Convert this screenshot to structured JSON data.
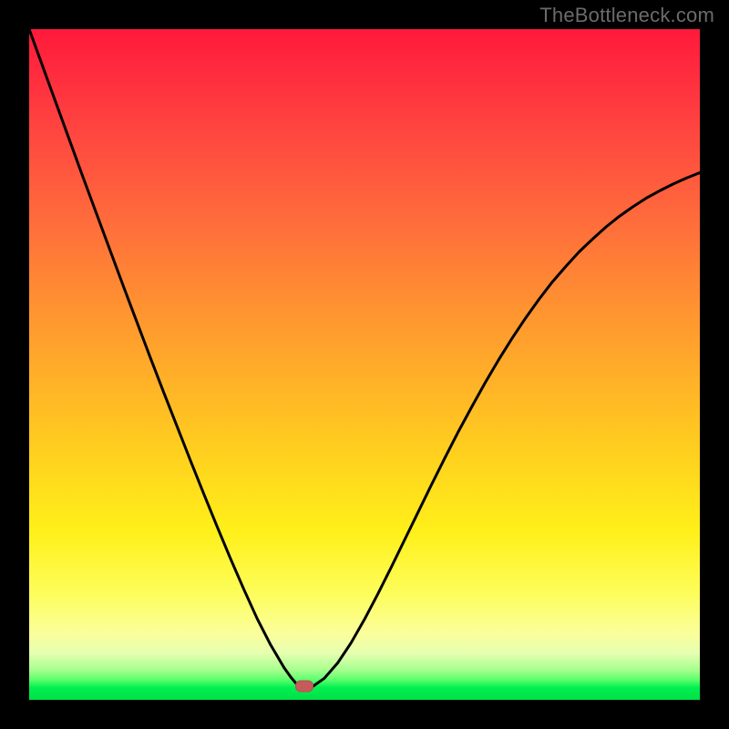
{
  "watermark": "TheBottleneck.com",
  "colors": {
    "frame": "#000000",
    "curve_stroke": "#000000",
    "marker_fill": "#c75a5a"
  },
  "chart_data": {
    "type": "line",
    "title": "",
    "xlabel": "",
    "ylabel": "",
    "xlim": [
      0,
      1
    ],
    "ylim": [
      0,
      1
    ],
    "x": [
      0.0,
      0.02,
      0.04,
      0.06,
      0.08,
      0.1,
      0.12,
      0.14,
      0.16,
      0.18,
      0.2,
      0.22,
      0.24,
      0.26,
      0.28,
      0.3,
      0.32,
      0.34,
      0.36,
      0.38,
      0.39,
      0.4,
      0.405,
      0.41,
      0.42,
      0.44,
      0.46,
      0.48,
      0.5,
      0.52,
      0.54,
      0.56,
      0.58,
      0.6,
      0.62,
      0.64,
      0.66,
      0.68,
      0.7,
      0.72,
      0.74,
      0.76,
      0.78,
      0.8,
      0.82,
      0.84,
      0.86,
      0.88,
      0.9,
      0.92,
      0.94,
      0.96,
      0.98,
      1.0
    ],
    "values": [
      1.0,
      0.945,
      0.89,
      0.835,
      0.78,
      0.726,
      0.672,
      0.618,
      0.565,
      0.512,
      0.46,
      0.409,
      0.358,
      0.308,
      0.259,
      0.211,
      0.165,
      0.121,
      0.082,
      0.048,
      0.034,
      0.022,
      0.017,
      0.016,
      0.018,
      0.032,
      0.055,
      0.085,
      0.12,
      0.158,
      0.198,
      0.239,
      0.28,
      0.321,
      0.361,
      0.4,
      0.437,
      0.473,
      0.507,
      0.539,
      0.569,
      0.597,
      0.623,
      0.646,
      0.668,
      0.687,
      0.705,
      0.721,
      0.735,
      0.748,
      0.759,
      0.769,
      0.778,
      0.786
    ],
    "series_name": "bottleneck_curve",
    "marker": {
      "x": 0.41,
      "y": 0.02
    },
    "grid": false,
    "legend": false
  }
}
